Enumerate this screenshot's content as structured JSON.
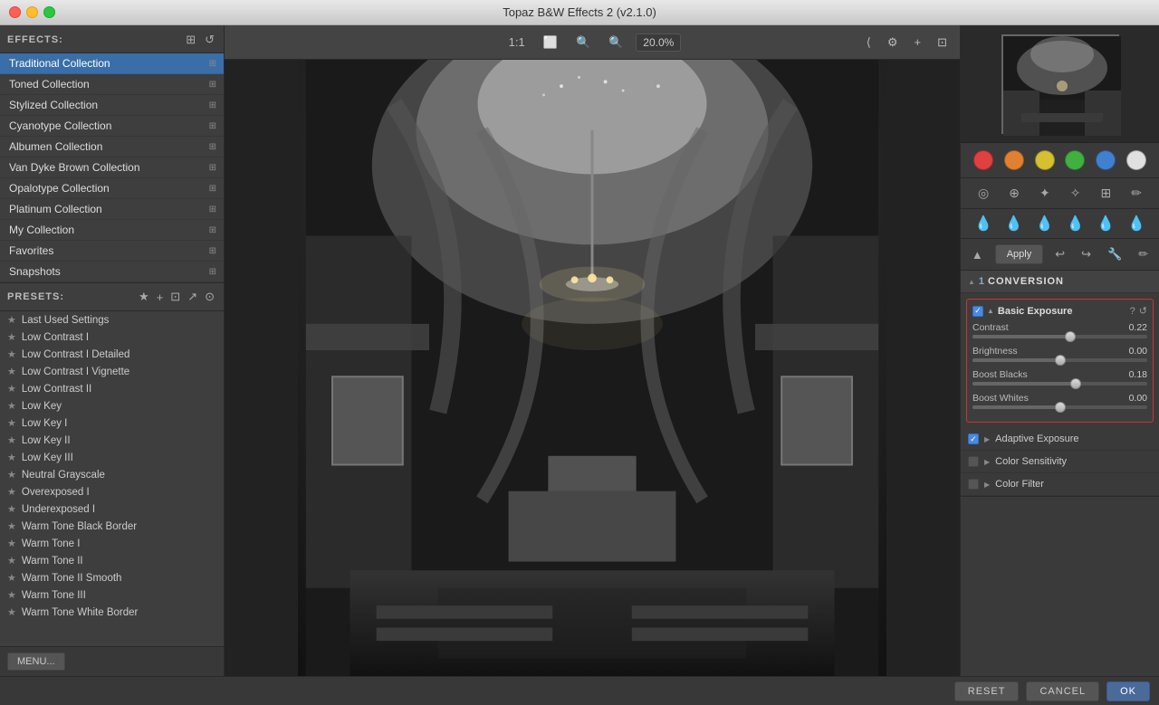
{
  "titlebar": {
    "title": "Topaz B&W Effects 2 (v2.1.0)"
  },
  "effects": {
    "label": "EFFECTS:",
    "collections": [
      {
        "name": "Traditional Collection",
        "active": true
      },
      {
        "name": "Toned Collection",
        "active": false
      },
      {
        "name": "Stylized Collection",
        "active": false
      },
      {
        "name": "Cyanotype Collection",
        "active": false
      },
      {
        "name": "Albumen Collection",
        "active": false
      },
      {
        "name": "Van Dyke Brown Collection",
        "active": false
      },
      {
        "name": "Opalotype Collection",
        "active": false
      },
      {
        "name": "Platinum Collection",
        "active": false
      },
      {
        "name": "My Collection",
        "active": false
      },
      {
        "name": "Favorites",
        "active": false
      },
      {
        "name": "Snapshots",
        "active": false
      }
    ]
  },
  "presets": {
    "label": "PRESETS:",
    "items": [
      {
        "name": "Last Used Settings"
      },
      {
        "name": "Low Contrast I"
      },
      {
        "name": "Low Contrast I Detailed"
      },
      {
        "name": "Low Contrast I Vignette"
      },
      {
        "name": "Low Contrast II"
      },
      {
        "name": "Low Key"
      },
      {
        "name": "Low Key I"
      },
      {
        "name": "Low Key II"
      },
      {
        "name": "Low Key III"
      },
      {
        "name": "Neutral Grayscale"
      },
      {
        "name": "Overexposed I"
      },
      {
        "name": "Underexposed I"
      },
      {
        "name": "Warm Tone Black Border"
      },
      {
        "name": "Warm Tone I"
      },
      {
        "name": "Warm Tone II"
      },
      {
        "name": "Warm Tone II Smooth"
      },
      {
        "name": "Warm Tone III"
      },
      {
        "name": "Warm Tone White Border"
      }
    ]
  },
  "menu_btn": "MENU...",
  "toolbar": {
    "zoom_label": "1:1",
    "zoom_percent": "20.0%"
  },
  "colors": {
    "red": "#e04040",
    "orange": "#e08030",
    "yellow": "#d4c030",
    "green": "#40b040",
    "blue": "#4080d0",
    "white": "#e0e0e0"
  },
  "apply_btn": "Apply",
  "conversion": {
    "section_num": "1",
    "title": "CONVERSION",
    "basic_exposure": {
      "title": "Basic Exposure",
      "contrast_label": "Contrast",
      "contrast_value": "0.22",
      "contrast_percent": 56,
      "brightness_label": "Brightness",
      "brightness_value": "0.00",
      "brightness_percent": 50,
      "boost_blacks_label": "Boost Blacks",
      "boost_blacks_value": "0.18",
      "boost_blacks_percent": 59,
      "boost_whites_label": "Boost Whites",
      "boost_whites_value": "0.00",
      "boost_whites_percent": 50
    },
    "adaptive_exposure": "Adaptive Exposure",
    "color_sensitivity": "Color Sensitivity",
    "color_filter": "Color Filter"
  },
  "bottom": {
    "reset": "RESET",
    "cancel": "CANCEL",
    "ok": "OK"
  }
}
